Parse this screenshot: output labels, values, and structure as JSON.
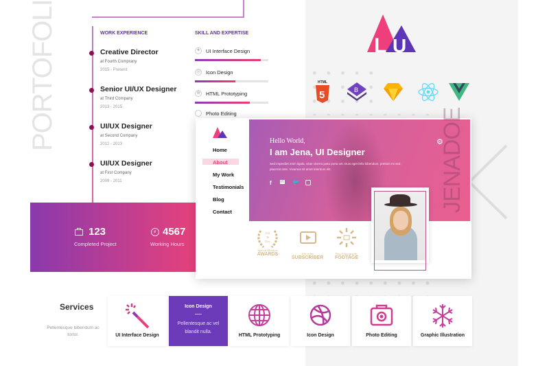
{
  "portfolio": {
    "vertical_title": "PORTOFOLIUX"
  },
  "work": {
    "heading": "WORK EXPERIENCE",
    "jobs": [
      {
        "title": "Creative Director",
        "company": "at Fourth Comprany",
        "years": "2015 - Present"
      },
      {
        "title": "Senior UI/UX Designer",
        "company": "at Third Company",
        "years": "2013 - 2015"
      },
      {
        "title": "UI/UX Designer",
        "company": "at Second Company",
        "years": "2012 - 2013"
      },
      {
        "title": "UI/UX Designer",
        "company": "at First Company",
        "years": "2009 - 2011"
      }
    ]
  },
  "skills": {
    "heading": "SKILL AND EXPERTISE",
    "items": [
      {
        "label": "UI Interface Design",
        "level": 0.9,
        "icon": "magic-wand-icon"
      },
      {
        "label": "Icon Design",
        "level": 0.55,
        "icon": "dribbble-icon"
      },
      {
        "label": "HTML Prototyping",
        "level": 0.75,
        "icon": "globe-icon"
      },
      {
        "label": "Photo Editing",
        "icon": "camera-icon"
      }
    ]
  },
  "stats": [
    {
      "value": "123",
      "label": "Completed Project",
      "icon": "briefcase-icon"
    },
    {
      "value": "4567",
      "label": "Working Hours",
      "icon": "clock-icon"
    }
  ],
  "logo": {
    "text": "LU",
    "colors": [
      "#ee3f7c",
      "#5c36b4"
    ]
  },
  "tech_icons": [
    "html5-icon",
    "bootstrap-icon",
    "sketch-icon",
    "react-icon",
    "vue-icon"
  ],
  "html5_label": "HTML",
  "bootstrap_label": "B",
  "mockup": {
    "nav": [
      "Home",
      "About",
      "My Work",
      "Testimonials",
      "Blog",
      "Contact"
    ],
    "active_nav": "About",
    "greeting": "Hello World,",
    "headline": "I am Jena, UI Designer",
    "intro": "Sed imperdiet enim ligula, vitae viverra justo porta vel. Duis eget felis bibendum, pretium mi sed, placerat ante. Vivamus sit amet interdum elit.",
    "social": [
      "f",
      "in",
      "t",
      "ig"
    ],
    "vertical_name": "JENADOE",
    "awards": [
      {
        "small": "Special Mention",
        "big": "AWARDS",
        "badge": "Fill 36 Day"
      },
      {
        "small": "10k video",
        "big": "SUBSCRIBER"
      },
      {
        "small": "Best Filmography",
        "big": "FOOTAGE"
      }
    ]
  },
  "services": {
    "title": "Services",
    "desc": "Pellentesque bibendum ac tortor.",
    "cards": [
      {
        "label": "UI Interface Design"
      },
      {
        "label": "Icon Design",
        "body": "Pellentesque ac  vel blandit nulla.",
        "active": true
      },
      {
        "label": "HTML Prototyping"
      },
      {
        "label": "Icon Design"
      },
      {
        "label": "Photo Editing"
      },
      {
        "label": "Graphic Illustration"
      }
    ]
  },
  "colors": {
    "accent_purple": "#5c36b4",
    "accent_pink": "#ee3f7c",
    "active_card": "#6a3ab8"
  }
}
